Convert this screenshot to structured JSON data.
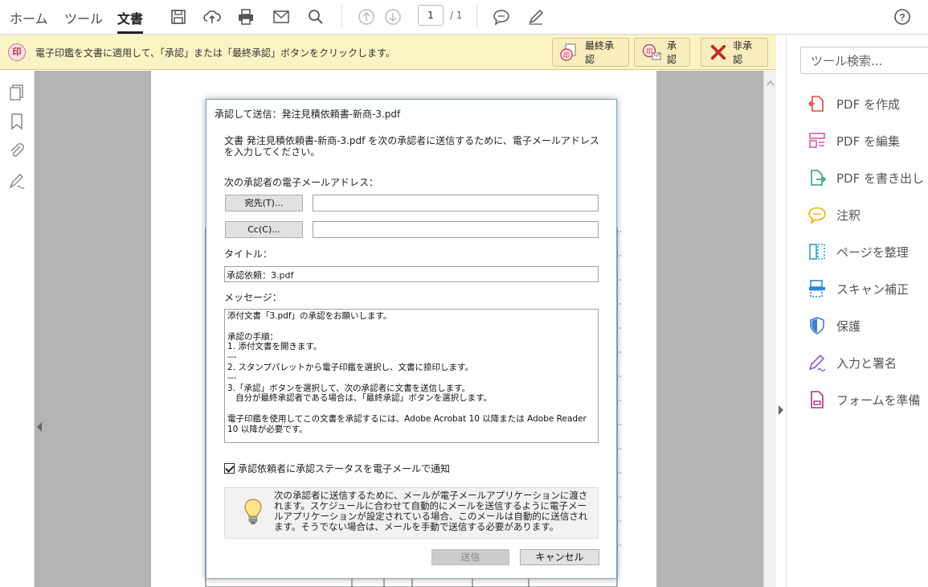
{
  "nav": {
    "home": "ホーム",
    "tools": "ツール",
    "document": "文書"
  },
  "toolbar": {
    "page_current": "1",
    "page_total": "/ 1",
    "icons": [
      "save-icon",
      "upload-icon",
      "print-icon",
      "email-icon",
      "search-icon",
      "page-up-icon",
      "page-down-icon",
      "comment-icon",
      "pen-icon",
      "help-icon"
    ]
  },
  "notification": {
    "icon_text": "印",
    "message": "電子印鑑を文書に適用して、「承認」または「最終承認」ボタンをクリックします。",
    "final_approve_label": "最終承認",
    "approve_label": "承認",
    "reject_label": "非承認"
  },
  "right_panel": {
    "search_placeholder": "ツール検索...",
    "tools": [
      {
        "label": "PDF を作成",
        "icon": "create-pdf-icon",
        "color": "#e04a3a"
      },
      {
        "label": "PDF を編集",
        "icon": "edit-pdf-icon",
        "color": "#e05aa8"
      },
      {
        "label": "PDF を書き出し",
        "icon": "export-pdf-icon",
        "color": "#2fa37a"
      },
      {
        "label": "注釈",
        "icon": "comment-tool-icon",
        "color": "#f0b400"
      },
      {
        "label": "ページを整理",
        "icon": "organize-pages-icon",
        "color": "#2aa0d6"
      },
      {
        "label": "スキャン補正",
        "icon": "scan-enhance-icon",
        "color": "#2a88d6"
      },
      {
        "label": "保護",
        "icon": "protect-icon",
        "color": "#3a7fd0"
      },
      {
        "label": "入力と署名",
        "icon": "fill-sign-icon",
        "color": "#8a5ad0"
      },
      {
        "label": "フォームを準備",
        "icon": "prepare-form-icon",
        "color": "#b0347a"
      }
    ]
  },
  "dialog": {
    "title": "承認して送信：発注見積依頼書-新商-3.pdf",
    "description": "文書 発注見積依頼書-新商-3.pdf を次の承認者に送信するために、電子メールアドレスを入力してください。",
    "email_label": "次の承認者の電子メールアドレス：",
    "to_button": "宛先(T)...",
    "to_value": "",
    "cc_button": "Cc(C)...",
    "cc_value": "",
    "title_label": "タイトル：",
    "title_value": "承認依頼：3.pdf",
    "message_label": "メッセージ：",
    "message_value": "添付文書「3.pdf」の承認をお願いします。\n\n承認の手順：\n1. 添付文書を開きます。\n---\n2. スタンプパレットから電子印鑑を選択し、文書に捺印します。\n---\n3.「承認」ボタンを選択して、次の承認者に文書を送信します。\n   自分が最終承認者である場合は、「最終承認」ボタンを選択します。\n\n電子印鑑を使用してこの文書を承認するには、Adobe Acrobat 10 以降または Adobe Reader 10 以降が必要です。",
    "notify_label": "承認依頼者に承認ステータスを電子メールで通知",
    "notify_checked": true,
    "info_text": "次の承認者に送信するために、メールが電子メールアプリケーションに渡されます。スケジュールに合わせて自動的にメールを送信するように電子メールアプリケーションが設定されている場合、このメールは自動的に送信されます。そうでない場合は、メールを手動で送信する必要があります。",
    "send_label": "送信",
    "cancel_label": "キャンセル"
  }
}
